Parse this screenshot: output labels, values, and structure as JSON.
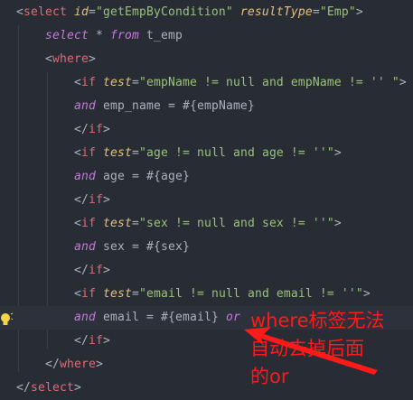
{
  "code": {
    "lines": [
      {
        "indent": 0,
        "tokens": [
          [
            "tag-punc",
            "<"
          ],
          [
            "tag",
            "select "
          ],
          [
            "attr",
            "id"
          ],
          [
            "p",
            "="
          ],
          [
            "str",
            "\"getEmpByCondition\" "
          ],
          [
            "attr",
            "resultType"
          ],
          [
            "p",
            "="
          ],
          [
            "str",
            "\"Emp\""
          ],
          [
            "p",
            ">"
          ]
        ]
      },
      {
        "indent": 1,
        "tokens": [
          [
            "kw",
            "select "
          ],
          [
            "p",
            "* "
          ],
          [
            "kw",
            "from "
          ],
          [
            "txt",
            "t_emp"
          ]
        ]
      },
      {
        "indent": 1,
        "tokens": [
          [
            "p",
            "<"
          ],
          [
            "tag",
            "where"
          ],
          [
            "p",
            ">"
          ]
        ]
      },
      {
        "indent": 2,
        "tokens": [
          [
            "p",
            "<"
          ],
          [
            "tag",
            "if "
          ],
          [
            "attr",
            "test"
          ],
          [
            "p",
            "="
          ],
          [
            "str",
            "\"empName != null and empName != '' \""
          ],
          [
            "p",
            ">"
          ]
        ]
      },
      {
        "indent": 2,
        "tokens": [
          [
            "kw",
            "and "
          ],
          [
            "txt",
            "emp_name = #{empName}"
          ]
        ]
      },
      {
        "indent": 2,
        "tokens": [
          [
            "p",
            "</"
          ],
          [
            "tag",
            "if"
          ],
          [
            "p",
            ">"
          ]
        ]
      },
      {
        "indent": 2,
        "tokens": [
          [
            "p",
            "<"
          ],
          [
            "tag",
            "if "
          ],
          [
            "attr",
            "test"
          ],
          [
            "p",
            "="
          ],
          [
            "str",
            "\"age != null and age != ''\""
          ],
          [
            "p",
            ">"
          ]
        ]
      },
      {
        "indent": 2,
        "tokens": [
          [
            "kw",
            "and "
          ],
          [
            "txt",
            "age = #{age}"
          ]
        ]
      },
      {
        "indent": 2,
        "tokens": [
          [
            "p",
            "</"
          ],
          [
            "tag",
            "if"
          ],
          [
            "p",
            ">"
          ]
        ]
      },
      {
        "indent": 2,
        "tokens": [
          [
            "p",
            "<"
          ],
          [
            "tag",
            "if "
          ],
          [
            "attr",
            "test"
          ],
          [
            "p",
            "="
          ],
          [
            "str",
            "\"sex != null and sex != ''\""
          ],
          [
            "p",
            ">"
          ]
        ]
      },
      {
        "indent": 2,
        "tokens": [
          [
            "kw",
            "and "
          ],
          [
            "txt",
            "sex = #{sex}"
          ]
        ]
      },
      {
        "indent": 2,
        "tokens": [
          [
            "p",
            "</"
          ],
          [
            "tag",
            "if"
          ],
          [
            "p",
            ">"
          ]
        ]
      },
      {
        "indent": 2,
        "tokens": [
          [
            "p",
            "<"
          ],
          [
            "tag",
            "if "
          ],
          [
            "attr",
            "test"
          ],
          [
            "p",
            "="
          ],
          [
            "str",
            "\"email != null and email != ''\""
          ],
          [
            "p",
            ">"
          ]
        ]
      },
      {
        "indent": 2,
        "highlight": true,
        "tokens": [
          [
            "kw",
            "and "
          ],
          [
            "txt",
            "email = #{email} "
          ],
          [
            "kw",
            "or"
          ]
        ]
      },
      {
        "indent": 2,
        "tokens": [
          [
            "p",
            "</"
          ],
          [
            "tag",
            "if"
          ],
          [
            "p",
            ">"
          ]
        ]
      },
      {
        "indent": 1,
        "tokens": [
          [
            "p",
            "</"
          ],
          [
            "tag",
            "where"
          ],
          [
            "p",
            ">"
          ]
        ]
      },
      {
        "indent": 0,
        "tokens": [
          [
            "p",
            "</"
          ],
          [
            "tag",
            "select"
          ],
          [
            "p",
            ">"
          ]
        ]
      }
    ]
  },
  "annotation": {
    "lines": [
      "where标签无法",
      "自动去掉后面",
      "的or"
    ],
    "color": "#ff1a1a"
  },
  "gutter": {
    "icon": "lightbulb-icon"
  }
}
